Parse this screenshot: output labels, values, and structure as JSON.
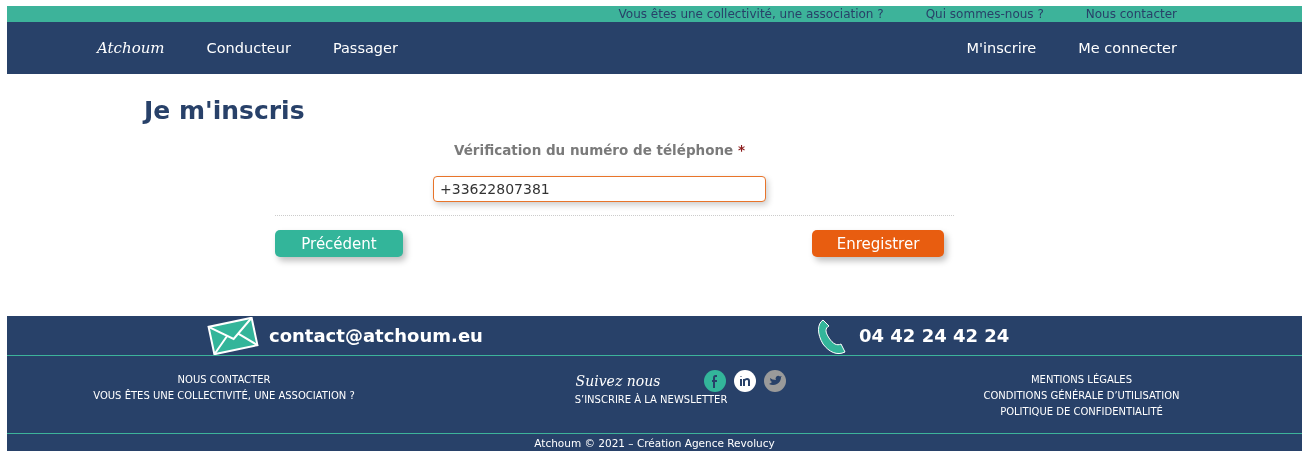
{
  "top_links": [
    "Vous êtes une collectivité, une association ?",
    "Qui sommes-nous ?",
    "Nous contacter"
  ],
  "nav": {
    "logo": "Atchoum",
    "left_items": [
      "Conducteur",
      "Passager"
    ],
    "right_items": [
      "M'inscrire",
      "Me connecter"
    ]
  },
  "page": {
    "title": "Je m'inscris",
    "field": {
      "label": "Vérification du numéro de téléphone",
      "required_mark": "*",
      "value": "+33622807381"
    },
    "buttons": [
      {
        "label": "Précédent",
        "kind": "secondary"
      },
      {
        "label": "Enregistrer",
        "kind": "primary"
      }
    ]
  },
  "footer": {
    "email": "contact@atchoum.eu",
    "phone": "04 42 24 42 24",
    "left_links": [
      "NOUS CONTACTER",
      "VOUS ÊTES UNE COLLECTIVITÉ, UNE ASSOCIATION ?"
    ],
    "social_title": "Suivez nous",
    "newsletter": "S’INSCRIRE À LA NEWSLETTER",
    "right_links": [
      "MENTIONS LÉGALES",
      "CONDITIONS GÉNÉRALE D’UTILISATION",
      "POLITIQUE DE CONFIDENTIALITÉ"
    ],
    "copyright": "Atchoum © 2021 – Création Agence Revolucy"
  }
}
